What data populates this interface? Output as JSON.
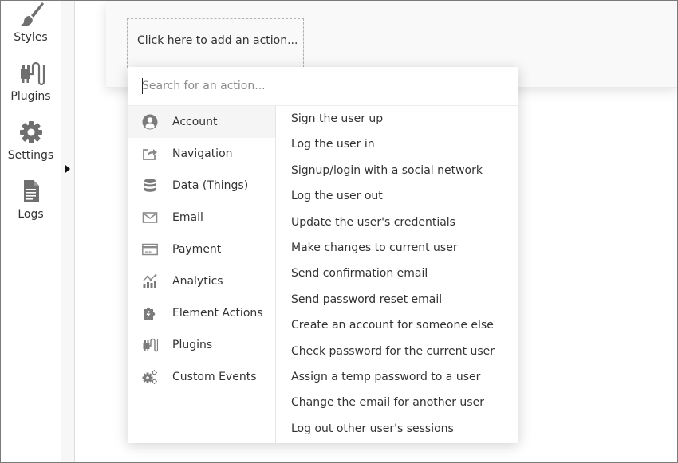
{
  "sidebar": {
    "items": [
      {
        "label": "Styles",
        "icon": "brush-icon"
      },
      {
        "label": "Plugins",
        "icon": "plug-icon"
      },
      {
        "label": "Settings",
        "icon": "gear-icon"
      },
      {
        "label": "Logs",
        "icon": "document-icon"
      }
    ]
  },
  "workflow": {
    "add_action_label": "Click here to add an action..."
  },
  "action_picker": {
    "search_placeholder": "Search for an action...",
    "search_value": "",
    "categories": [
      {
        "label": "Account",
        "icon": "user-circle-icon",
        "active": true
      },
      {
        "label": "Navigation",
        "icon": "share-arrow-icon"
      },
      {
        "label": "Data (Things)",
        "icon": "database-icon"
      },
      {
        "label": "Email",
        "icon": "envelope-icon"
      },
      {
        "label": "Payment",
        "icon": "credit-card-icon"
      },
      {
        "label": "Analytics",
        "icon": "analytics-chart-icon"
      },
      {
        "label": "Element Actions",
        "icon": "puzzle-bolt-icon"
      },
      {
        "label": "Plugins",
        "icon": "plug-icon"
      },
      {
        "label": "Custom Events",
        "icon": "gears-icon"
      }
    ],
    "actions": [
      "Sign the user up",
      "Log the user in",
      "Signup/login with a social network",
      "Log the user out",
      "Update the user's credentials",
      "Make changes to current user",
      "Send confirmation email",
      "Send password reset email",
      "Create an account for someone else",
      "Check password for the current user",
      "Assign a temp password to a user",
      "Change the email for another user",
      "Log out other user's sessions"
    ]
  },
  "colors": {
    "icon_gray": "#7b7b7b",
    "active_category_bg": "#f5f5f5",
    "card_bg": "#f9f9f9"
  }
}
